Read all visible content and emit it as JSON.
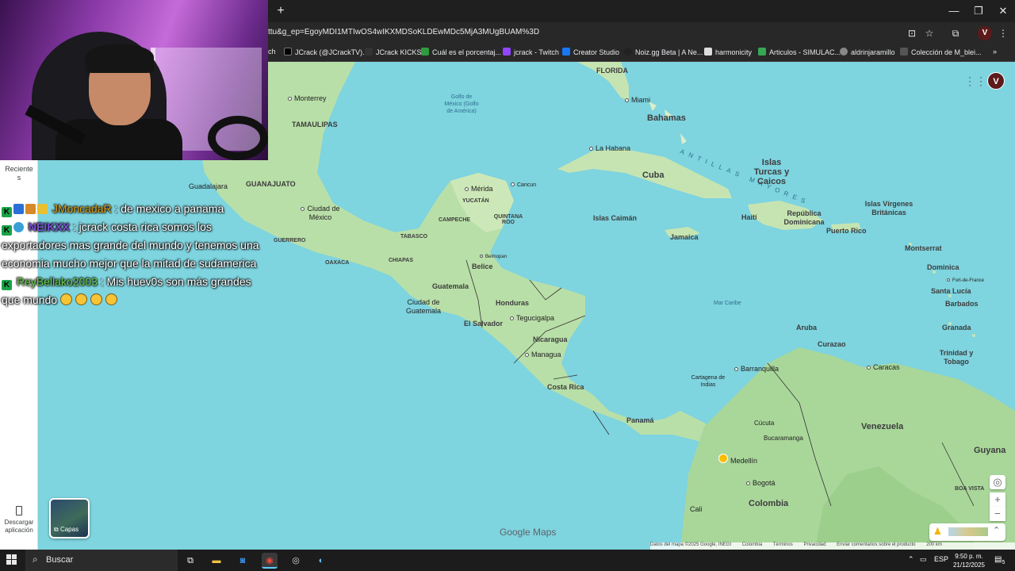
{
  "browser": {
    "url": "ttu&g_ep=EgoyMDI1MTIwOS4wIKXMDSoKLDEwMDc5MjA3MUgBUAM%3D",
    "new_tab_icon": "+",
    "window_controls": {
      "minimize": "—",
      "restore": "❐",
      "close": "✕"
    },
    "bookmarks": [
      {
        "label": "ch",
        "color": "#444444"
      },
      {
        "label": "JCrack (@JCrackTV)...",
        "color": "#000000"
      },
      {
        "label": "JCrack KICKS",
        "color": "#333333"
      },
      {
        "label": "Cuál es el porcentaj...",
        "color": "#2e9b3f"
      },
      {
        "label": "jcrack - Twitch",
        "color": "#9146ff"
      },
      {
        "label": "Creator Studio",
        "color": "#1877f2"
      },
      {
        "label": "Noiz.gg Beta | A Ne...",
        "color": "#222222"
      },
      {
        "label": "harmonicity",
        "color": "#dddddd"
      },
      {
        "label": "Articulos - SIMULAC...",
        "color": "#34a853"
      },
      {
        "label": "aldrinjaramillo",
        "color": "#888888"
      },
      {
        "label": "Colección de M_blei...",
        "color": "#555555"
      }
    ],
    "bookmarks_more": "»",
    "profile_letter": "V"
  },
  "sidebar": {
    "recent_label": "Reciente s",
    "download_label": "Descargar aplicación",
    "layers_label": "Capas"
  },
  "map": {
    "labels": {
      "florida": "FLORIDA",
      "miami": "Miami",
      "bahamas": "Bahamas",
      "monterrey": "Monterrey",
      "golfo": "Golfo de México (Golfo de América)",
      "tamaulipas": "TAMAULIPAS",
      "la_habana": "La Habana",
      "antillas": "ANTILLAS MAYORES",
      "islas_turcas": "Islas Turcas y Caicos",
      "cuba": "Cuba",
      "guadalajara": "Guadalajara",
      "guanajuato": "GUANAJUATO",
      "merida": "Mérida",
      "cancun": "Cancun",
      "yucatan": "YUCATÁN",
      "ciudad_mexico": "Ciudad de México",
      "campeche": "CAMPECHE",
      "quintana_roo": "QUINTANA ROO",
      "islas_caiman": "Islas Caimán",
      "haiti": "Haití",
      "rep_dominicana": "República Dominicana",
      "puerto_rico": "Puerto Rico",
      "islas_virgenes": "Islas Vírgenes Británicas",
      "tabasco": "TABASCO",
      "jamaica": "Jamaica",
      "guerrero": "GUERRERO",
      "oaxaca": "OAXACA",
      "chiapas": "CHIAPAS",
      "belmopan": "Belmopan",
      "belice": "Belice",
      "montserrat": "Montserrat",
      "dominica": "Dominica",
      "fort_de_france": "Fort-de-France",
      "santa_lucia": "Santa Lucía",
      "guatemala": "Guatemala",
      "honduras": "Honduras",
      "mar_caribe": "Mar Caribe",
      "barbados": "Barbados",
      "ciudad_guatemala": "Ciudad de Guatemala",
      "tegucigalpa": "Tegucigalpa",
      "el_salvador": "El Salvador",
      "aruba": "Aruba",
      "granada": "Granada",
      "nicaragua": "Nicaragua",
      "curazao": "Curazao",
      "trinidad": "Trinidad y Tobago",
      "managua": "Managua",
      "barranquilla": "Barranquilla",
      "caracas": "Caracas",
      "cartagena": "Cartagena de Indias",
      "costa_rica": "Costa Rica",
      "panama": "Panamá",
      "cucuta": "Cúcuta",
      "venezuela": "Venezuela",
      "bucaramanga": "Bucaramanga",
      "guyana": "Guyana",
      "medellin": "Medellín",
      "bogota": "Bogotá",
      "cali": "Cali",
      "colombia": "Colombia",
      "boa_vista": "BOA VISTA"
    },
    "logo": "Google Maps",
    "footer": [
      "Datos del mapa ©2025 Google, INEGI",
      "Colombia",
      "Términos",
      "Privacidad",
      "Enviar comentarios sobre el producto",
      "200 km"
    ],
    "zoom_in": "+",
    "zoom_out": "−"
  },
  "chat": [
    {
      "user": "JMoncadaR",
      "message": ": de mexico a panama"
    },
    {
      "user": "NEIKXX",
      "message": ": jcrack costa rica somos los exportadores mas grande del mundo y tenemos una economia mucho mejor que la mitad de sudamerica"
    },
    {
      "user": "ReyBellako2003",
      "message": ": Mis huev0s son más grandes que mundo"
    }
  ],
  "taskbar": {
    "search_label": "Buscar",
    "language": "ESP",
    "time": "9:50 p. m.",
    "date": "21/12/2025",
    "notif_count": "5"
  },
  "icons": {
    "windows": "windows-logo-icon",
    "search": "search-icon",
    "grid": "apps-grid-icon"
  }
}
